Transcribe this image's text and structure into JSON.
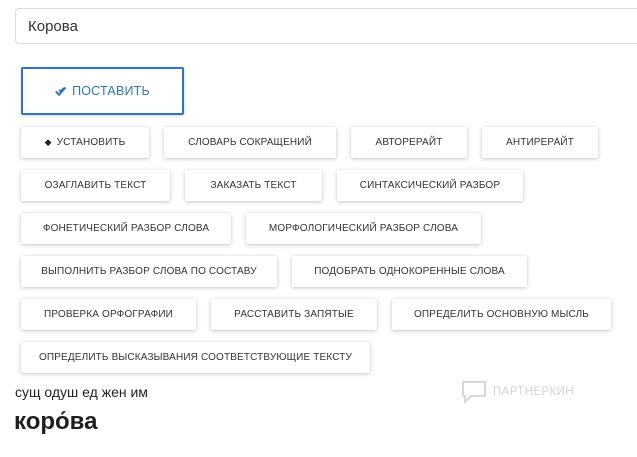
{
  "search": {
    "value": "Корова"
  },
  "main_button": {
    "label": "Поставить",
    "icon": "double-check-icon",
    "color": "#2f74c0"
  },
  "buttons": [
    {
      "label": "Установить",
      "icon": "diamond-icon"
    },
    {
      "label": "Словарь сокращений"
    },
    {
      "label": "Авторерайт"
    },
    {
      "label": "Антирерайт"
    },
    {
      "label": "Озаглавить текст"
    },
    {
      "label": "Заказать текст"
    },
    {
      "label": "Синтаксический разбор"
    },
    {
      "label": "Фонетический разбор слова"
    },
    {
      "label": "Морфологический разбор слова"
    },
    {
      "label": "Выполнить разбор слова по составу"
    },
    {
      "label": "Подобрать однокоренные слова"
    },
    {
      "label": "Проверка орфографии"
    },
    {
      "label": "Расставить запятые"
    },
    {
      "label": "Определить основную мысль"
    },
    {
      "label": "Определить высказывания соответствующие тексту"
    }
  ],
  "result": {
    "morphology": "сущ одуш ед жен им",
    "accented_word": "коро́ва"
  },
  "watermark": {
    "label": "ПАРТНЕРКИН",
    "icon": "chat-bubble-icon"
  }
}
